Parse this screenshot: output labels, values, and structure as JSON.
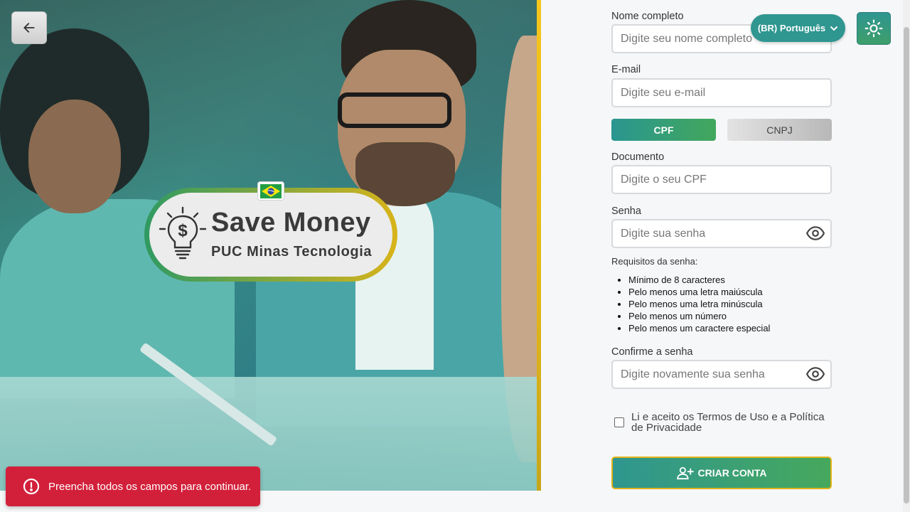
{
  "hero": {
    "logo_title": "Save Money",
    "logo_subtitle": "PUC Minas Tecnologia"
  },
  "toast": {
    "message": "Preencha todos os campos para continuar.",
    "color": "#d3203a"
  },
  "header": {
    "language_label": "(BR) Português"
  },
  "form": {
    "name_label": "Nome completo",
    "name_placeholder": "Digite seu nome completo",
    "email_label": "E-mail",
    "email_placeholder": "Digite seu e-mail",
    "doc_type_cpf": "CPF",
    "doc_type_cnpj": "CNPJ",
    "doc_type_selected": "CPF",
    "document_label": "Documento",
    "document_placeholder": "Digite o seu CPF",
    "password_label": "Senha",
    "password_placeholder": "Digite sua senha",
    "requirements_title": "Requisitos da senha:",
    "requirements": [
      "Mínimo de 8 caracteres",
      "Pelo menos uma letra maiúscula",
      "Pelo menos uma letra minúscula",
      "Pelo menos um número",
      "Pelo menos um caractere especial"
    ],
    "confirm_label": "Confirme a senha",
    "confirm_placeholder": "Digite novamente sua senha",
    "terms_text": "Li e aceito os Termos de Uso e a Política de Privacidade",
    "terms_checked": false,
    "submit_label": "CRIAR CONTA"
  },
  "colors": {
    "accent": "#2f9690",
    "accent_green": "#46a85c",
    "gold": "#e2b31a"
  }
}
